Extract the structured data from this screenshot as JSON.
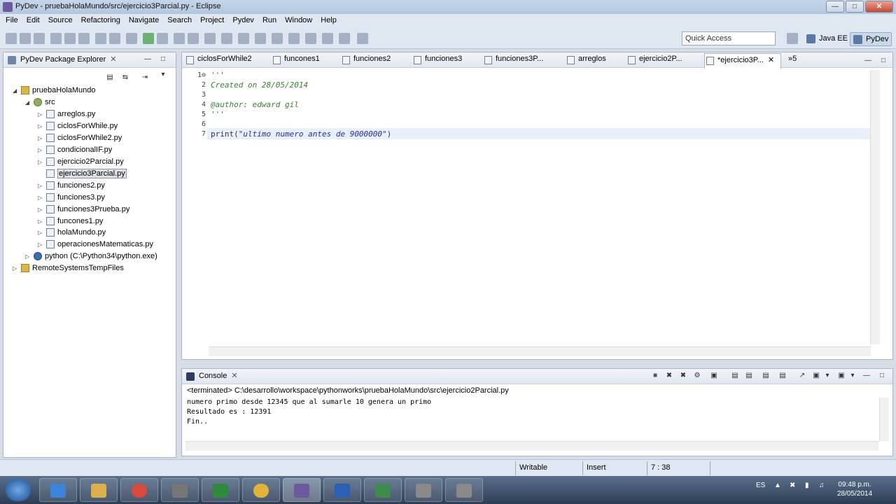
{
  "window": {
    "title": "PyDev - pruebaHolaMundo/src/ejercicio3Parcial.py - Eclipse"
  },
  "menubar": [
    "File",
    "Edit",
    "Source",
    "Refactoring",
    "Navigate",
    "Search",
    "Project",
    "Pydev",
    "Run",
    "Window",
    "Help"
  ],
  "toolbar": {
    "quick_access": "Quick Access",
    "perspectives": [
      "Java EE",
      "PyDev"
    ]
  },
  "explorer": {
    "title": "PyDev Package Explorer",
    "tree": [
      {
        "label": "pruebaHolaMundo"
      },
      {
        "label": "src"
      },
      {
        "label": "arreglos.py"
      },
      {
        "label": "ciclosForWhile.py"
      },
      {
        "label": "ciclosForWhile2.py"
      },
      {
        "label": "condicionalIF.py"
      },
      {
        "label": "ejercicio2Parcial.py"
      },
      {
        "label": "ejercicio3Parcial.py"
      },
      {
        "label": "funciones2.py"
      },
      {
        "label": "funciones3.py"
      },
      {
        "label": "funciones3Prueba.py"
      },
      {
        "label": "funcones1.py"
      },
      {
        "label": "holaMundo.py"
      },
      {
        "label": "operacionesMatematicas.py"
      },
      {
        "label": "python  (C:\\Python34\\python.exe)"
      },
      {
        "label": "RemoteSystemsTempFiles"
      }
    ]
  },
  "editor": {
    "tabs": [
      "ciclosForWhile2",
      "funcones1",
      "funciones2",
      "funciones3",
      "funciones3P...",
      "arreglos",
      "ejercicio2P...",
      "*ejercicio3P..."
    ],
    "overflow_count": "5",
    "lines": [
      {
        "num": "1⊖",
        "text": "'''"
      },
      {
        "num": "2",
        "text": "Created on 28/05/2014"
      },
      {
        "num": "3",
        "text": ""
      },
      {
        "num": "4",
        "text": "@author: edward gil"
      },
      {
        "num": "5",
        "text": "'''"
      },
      {
        "num": "6",
        "text": ""
      },
      {
        "num": "7",
        "text": "print(\"ultimo numero antes de 9000000\")"
      }
    ],
    "print_kw": "print(",
    "print_str": "\"ultimo numero antes de 9000000\"",
    "print_close": ")"
  },
  "console": {
    "title": "Console",
    "header": "<terminated> C:\\desarrollo\\workspace\\pythonworks\\pruebaHolaMundo\\src\\ejercicio2Parcial.py",
    "output": [
      "numero primo desde 12345 que al sumarle 10 genera un primo",
      "Resultado es : 12391",
      "Fin.."
    ]
  },
  "status": {
    "writable": "Writable",
    "mode": "Insert",
    "position": "7 : 38"
  },
  "taskbar": {
    "lang": "ES",
    "time": "09:48 p.m.",
    "date": "28/05/2014"
  }
}
